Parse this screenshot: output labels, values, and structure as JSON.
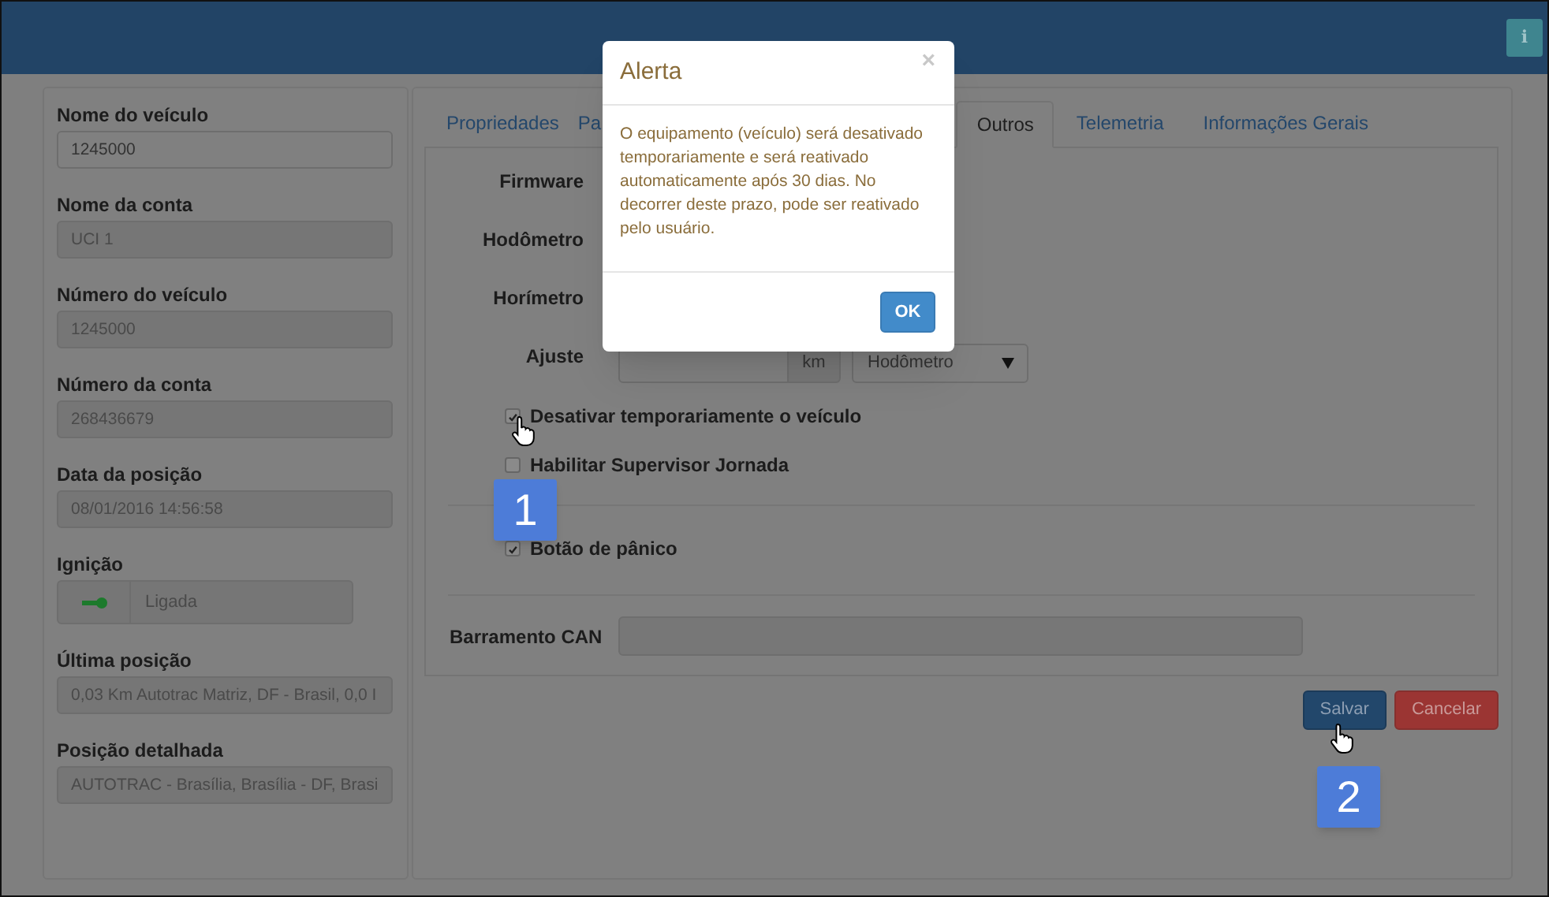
{
  "header": {
    "info_button": "i"
  },
  "vehicle_fields": [
    {
      "kind": "text",
      "label": "Nome do veículo",
      "value": "1245000",
      "disabled": false
    },
    {
      "kind": "text",
      "label": "Nome da conta",
      "value": "UCI 1",
      "disabled": true
    },
    {
      "kind": "text",
      "label": "Número do veículo",
      "value": "1245000",
      "disabled": true
    },
    {
      "kind": "text",
      "label": "Número da conta",
      "value": "268436679",
      "disabled": true
    },
    {
      "kind": "text",
      "label": "Data da posição",
      "value": "08/01/2016 14:56:58",
      "disabled": true
    },
    {
      "kind": "ignition",
      "label": "Ignição",
      "value": "Ligada",
      "disabled": true
    },
    {
      "kind": "text",
      "label": "Última posição",
      "value": "0,03 Km Autotrac Matriz, DF - Brasil, 0,0 I",
      "disabled": true
    },
    {
      "kind": "text",
      "label": "Posição detalhada",
      "value": "AUTOTRAC - Brasília, Brasília - DF, Brasi",
      "disabled": true
    }
  ],
  "tabs": [
    {
      "label": "Propriedades",
      "selected": false
    },
    {
      "label": "Pa",
      "selected": false
    },
    {
      "label": "Outros",
      "selected": true
    },
    {
      "label": "Telemetria",
      "selected": false
    },
    {
      "label": "Informações Gerais",
      "selected": false
    }
  ],
  "form_rows": [
    {
      "kind": "covered",
      "label": "Firmware"
    },
    {
      "kind": "covered",
      "label": "Hodômetro"
    },
    {
      "kind": "covered",
      "label": "Horímetro"
    },
    {
      "kind": "adjust",
      "label": "Ajuste",
      "unit": "km",
      "select": "Hodômetro"
    }
  ],
  "checkbox_groups": [
    [
      {
        "label": "Desativar temporariamente o veículo",
        "checked": true
      },
      {
        "label": "Habilitar Supervisor Jornada",
        "checked": false
      }
    ],
    [
      {
        "label": "Botão de pânico",
        "checked": true
      }
    ]
  ],
  "can_bus": {
    "label": "Barramento CAN"
  },
  "buttons": [
    {
      "kind": "primary",
      "label": "Salvar"
    },
    {
      "kind": "danger",
      "label": "Cancelar"
    }
  ],
  "modal": {
    "title": "Alerta",
    "close": "×",
    "message": "O equipamento (veículo) será desativado temporariamente e será reativado automaticamente após 30 dias. No decorrer deste prazo, pode ser reativado pelo usuário.",
    "button": "OK"
  },
  "callouts": [
    {
      "number": "1"
    },
    {
      "number": "2"
    }
  ]
}
